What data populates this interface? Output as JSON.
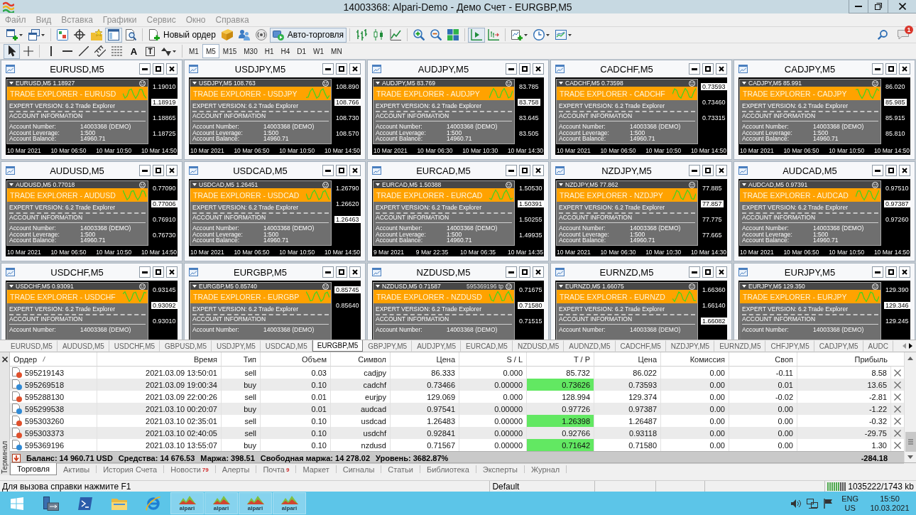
{
  "window": {
    "title": "14003368: Alpari-Demo - Демо Счет - EURGBP,M5"
  },
  "menu": [
    "Файл",
    "Вид",
    "Вставка",
    "Графики",
    "Сервис",
    "Окно",
    "Справка"
  ],
  "toolbar": [
    [
      {
        "kind": "new-chart",
        "pressed": false
      },
      {
        "kind": "profiles",
        "pressed": false
      }
    ],
    [
      {
        "kind": "market-watch",
        "pressed": false
      },
      {
        "kind": "data-window",
        "pressed": false
      },
      {
        "kind": "navigator",
        "pressed": false
      },
      {
        "kind": "terminal",
        "pressed": true
      },
      {
        "kind": "tester",
        "pressed": false
      }
    ],
    [
      {
        "kind": "new-order",
        "label": "Новый ордер",
        "pressed": false
      },
      {
        "kind": "editor",
        "pressed": false
      },
      {
        "kind": "community",
        "pressed": false
      },
      {
        "kind": "signals",
        "pressed": false
      },
      {
        "kind": "autotrading",
        "label": "Авто-торговля",
        "pressed": true
      }
    ],
    [
      {
        "kind": "bars",
        "pressed": false
      },
      {
        "kind": "candles",
        "pressed": false
      },
      {
        "kind": "line",
        "pressed": false
      }
    ],
    [
      {
        "kind": "zoom-in",
        "pressed": false
      },
      {
        "kind": "zoom-out",
        "pressed": false
      },
      {
        "kind": "tile",
        "pressed": false
      }
    ],
    [
      {
        "kind": "autoscroll",
        "pressed": true
      },
      {
        "kind": "shift",
        "pressed": false
      }
    ],
    [
      {
        "kind": "indicators",
        "pressed": false
      },
      {
        "kind": "periods",
        "pressed": false
      },
      {
        "kind": "templates",
        "pressed": false
      }
    ]
  ],
  "toolbar_right": {
    "notifications": "1"
  },
  "drawing_tools": [
    [
      {
        "kind": "cursor",
        "selected": true
      },
      {
        "kind": "crosshair",
        "selected": false
      }
    ],
    [
      {
        "kind": "vertical-line",
        "selected": false
      },
      {
        "kind": "horizontal-line",
        "selected": false
      },
      {
        "kind": "trendline",
        "selected": false
      },
      {
        "kind": "channel",
        "selected": false
      },
      {
        "kind": "fibonacci",
        "selected": false
      },
      {
        "kind": "text",
        "label": "A",
        "selected": false
      },
      {
        "kind": "text-label",
        "label": "T",
        "selected": false
      },
      {
        "kind": "arrows",
        "selected": false
      }
    ]
  ],
  "periods": [
    {
      "label": "M1",
      "selected": false
    },
    {
      "label": "M5",
      "selected": true
    },
    {
      "label": "M15",
      "selected": false
    },
    {
      "label": "M30",
      "selected": false
    },
    {
      "label": "H1",
      "selected": false
    },
    {
      "label": "H4",
      "selected": false
    },
    {
      "label": "D1",
      "selected": false
    },
    {
      "label": "W1",
      "selected": false
    },
    {
      "label": "MN",
      "selected": false
    }
  ],
  "charts": [
    {
      "title": "EURUSD,M5",
      "header": "EURUSD,M5 1.18927",
      "band": "TRADE EXPLORER - EURUSD",
      "info": [
        "EXPERT VERSION: 6.2 Trade Explorer",
        "ACCOUNT INFORMATION"
      ],
      "account": [
        {
          "label": "Account Number:",
          "value": "14003368 (DEMO)"
        },
        {
          "label": "Account Leverage:",
          "value": "1:500"
        },
        {
          "label": "Account Balance:",
          "value": "14960.71"
        }
      ],
      "prices": [
        {
          "text": "1.19010",
          "current": false
        },
        {
          "text": "1.18919",
          "current": true
        },
        {
          "text": "1.18865",
          "current": false
        },
        {
          "text": "1.18725",
          "current": false
        }
      ],
      "times": [
        "10 Mar 2021",
        "10 Mar 06:50",
        "10 Mar 10:50",
        "10 Mar 14:50"
      ]
    },
    {
      "title": "USDJPY,M5",
      "header": "USDJPY,M5 108.763",
      "band": "TRADE EXPLORER - USDJPY",
      "info": [
        "EXPERT VERSION: 6.2 Trade Explorer",
        "ACCOUNT INFORMATION"
      ],
      "account": [
        {
          "label": "Account Number:",
          "value": "14003368 (DEMO)"
        },
        {
          "label": "Account Leverage:",
          "value": "1:500"
        },
        {
          "label": "Account Balance:",
          "value": "14960.71"
        }
      ],
      "prices": [
        {
          "text": "108.890",
          "current": false
        },
        {
          "text": "108.766",
          "current": true
        },
        {
          "text": "108.730",
          "current": false
        },
        {
          "text": "108.570",
          "current": false
        }
      ],
      "times": [
        "10 Mar 2021",
        "10 Mar 06:50",
        "10 Mar 10:50",
        "10 Mar 14:50"
      ]
    },
    {
      "title": "AUDJPY,M5",
      "header": "AUDJPY,M5 83.769",
      "band": "TRADE EXPLORER - AUDJPY",
      "info": [
        "EXPERT VERSION: 6.2 Trade Explorer",
        "ACCOUNT INFORMATION"
      ],
      "account": [
        {
          "label": "Account Number:",
          "value": "14003368 (DEMO)"
        },
        {
          "label": "Account Leverage:",
          "value": "1:500"
        },
        {
          "label": "Account Balance:",
          "value": "14960.71"
        }
      ],
      "prices": [
        {
          "text": "83.785",
          "current": false
        },
        {
          "text": "83.758",
          "current": true
        },
        {
          "text": "83.645",
          "current": false
        },
        {
          "text": "83.505",
          "current": false
        }
      ],
      "times": [
        "10 Mar 2021",
        "10 Mar 06:30",
        "10 Mar 10:30",
        "10 Mar 14:30"
      ]
    },
    {
      "title": "CADCHF,M5",
      "header": "CADCHF,M5 0.73598",
      "band": "TRADE EXPLORER - CADCHF",
      "info": [
        "EXPERT VERSION: 6.2 Trade Explorer",
        "ACCOUNT INFORMATION"
      ],
      "account": [
        {
          "label": "Account Number:",
          "value": "14003368 (DEMO)"
        },
        {
          "label": "Account Leverage:",
          "value": "1:500"
        },
        {
          "label": "Account Balance:",
          "value": "14960.71"
        }
      ],
      "prices": [
        {
          "text": "0.73593",
          "current": true
        },
        {
          "text": "0.73460",
          "current": false
        },
        {
          "text": "0.73315",
          "current": false
        }
      ],
      "times": [
        "10 Mar 2021",
        "10 Mar 06:50",
        "10 Mar 10:50",
        "10 Mar 14:50"
      ]
    },
    {
      "title": "CADJPY,M5",
      "header": "CADJPY,M5 85.991",
      "band": "TRADE EXPLORER - CADJPY",
      "info": [
        "EXPERT VERSION: 6.2 Trade Explorer",
        "ACCOUNT INFORMATION"
      ],
      "account": [
        {
          "label": "Account Number:",
          "value": "14003368 (DEMO)"
        },
        {
          "label": "Account Leverage:",
          "value": "1:500"
        },
        {
          "label": "Account Balance:",
          "value": "14960.71"
        }
      ],
      "prices": [
        {
          "text": "86.020",
          "current": false
        },
        {
          "text": "85.985",
          "current": true
        },
        {
          "text": "85.915",
          "current": false
        },
        {
          "text": "85.810",
          "current": false
        }
      ],
      "times": [
        "10 Mar 2021",
        "10 Mar 06:50",
        "10 Mar 10:50",
        "10 Mar 14:50"
      ]
    },
    {
      "title": "AUDUSD,M5",
      "header": "AUDUSD,M5 0.77018",
      "band": "TRADE EXPLORER - AUDUSD",
      "info": [
        "EXPERT VERSION: 6.2 Trade Explorer",
        "ACCOUNT INFORMATION"
      ],
      "account": [
        {
          "label": "Account Number:",
          "value": "14003368 (DEMO)"
        },
        {
          "label": "Account Leverage:",
          "value": "1:500"
        },
        {
          "label": "Account Balance:",
          "value": "14960.71"
        }
      ],
      "prices": [
        {
          "text": "0.77090",
          "current": false
        },
        {
          "text": "0.77006",
          "current": true
        },
        {
          "text": "0.76910",
          "current": false
        },
        {
          "text": "0.76730",
          "current": false
        }
      ],
      "times": [
        "10 Mar 2021",
        "10 Mar 06:50",
        "10 Mar 10:50",
        "10 Mar 14:50"
      ]
    },
    {
      "title": "USDCAD,M5",
      "header": "USDCAD,M5 1.26451",
      "band": "TRADE EXPLORER - USDCAD",
      "info": [
        "EXPERT VERSION: 6.2 Trade Explorer",
        "ACCOUNT INFORMATION"
      ],
      "account": [
        {
          "label": "Account Number:",
          "value": "14003368 (DEMO)"
        },
        {
          "label": "Account Leverage:",
          "value": "1:500"
        },
        {
          "label": "Account Balance:",
          "value": "14960.71"
        }
      ],
      "prices": [
        {
          "text": "1.26790",
          "current": false
        },
        {
          "text": "1.26620",
          "current": false
        },
        {
          "text": "1.26463",
          "current": true
        }
      ],
      "times": [
        "10 Mar 2021",
        "10 Mar 06:50",
        "10 Mar 10:50",
        "10 Mar 14:50"
      ]
    },
    {
      "title": "EURCAD,M5",
      "header": "EURCAD,M5 1.50388",
      "band": "TRADE EXPLORER - EURCAD",
      "info": [
        "EXPERT VERSION: 6.2 Trade Explorer",
        "ACCOUNT INFORMATION"
      ],
      "account": [
        {
          "label": "Account Number:",
          "value": "14003368 (DEMO)"
        },
        {
          "label": "Account Leverage:",
          "value": "1:500"
        },
        {
          "label": "Account Balance:",
          "value": "14960.71"
        }
      ],
      "prices": [
        {
          "text": "1.50530",
          "current": false
        },
        {
          "text": "1.50391",
          "current": true
        },
        {
          "text": "1.50255",
          "current": false
        },
        {
          "text": "1.49935",
          "current": false
        }
      ],
      "times": [
        "9 Mar 2021",
        "9 Mar 22:35",
        "10 Mar 06:35",
        "10 Mar 14:35"
      ]
    },
    {
      "title": "NZDJPY,M5",
      "header": "NZDJPY,M5 77.862",
      "band": "TRADE EXPLORER - NZDJPY",
      "info": [
        "EXPERT VERSION: 6.2 Trade Explorer",
        "ACCOUNT INFORMATION"
      ],
      "account": [
        {
          "label": "Account Number:",
          "value": "14003368 (DEMO)"
        },
        {
          "label": "Account Leverage:",
          "value": "1:500"
        },
        {
          "label": "Account Balance:",
          "value": "14960.71"
        }
      ],
      "prices": [
        {
          "text": "77.885",
          "current": false
        },
        {
          "text": "77.857",
          "current": true
        },
        {
          "text": "77.775",
          "current": false
        },
        {
          "text": "77.665",
          "current": false
        }
      ],
      "times": [
        "10 Mar 2021",
        "10 Mar 06:30",
        "10 Mar 10:30",
        "10 Mar 14:30"
      ]
    },
    {
      "title": "AUDCAD,M5",
      "header": "AUDCAD,M5 0.97391",
      "band": "TRADE EXPLORER - AUDCAD",
      "info": [
        "EXPERT VERSION: 6.2 Trade Explorer",
        "ACCOUNT INFORMATION"
      ],
      "account": [
        {
          "label": "Account Number:",
          "value": "14003368 (DEMO)"
        },
        {
          "label": "Account Leverage:",
          "value": "1:500"
        },
        {
          "label": "Account Balance:",
          "value": "14960.71"
        }
      ],
      "prices": [
        {
          "text": "0.97510",
          "current": false
        },
        {
          "text": "0.97387",
          "current": true
        },
        {
          "text": "0.97260",
          "current": false
        }
      ],
      "times": [
        "10 Mar 2021",
        "10 Mar 06:50",
        "10 Mar 10:50",
        "10 Mar 14:50"
      ]
    },
    {
      "title": "USDCHF,M5",
      "header": "USDCHF,M5 0.93091",
      "band": "TRADE EXPLORER - USDCHF",
      "info": [
        "EXPERT VERSION: 6.2 Trade Explorer",
        "ACCOUNT INFORMATION"
      ],
      "account": [
        {
          "label": "Account Number:",
          "value": "14003368 (DEMO)"
        }
      ],
      "prices": [
        {
          "text": "0.93145",
          "current": false
        },
        {
          "text": "0.93092",
          "current": true
        },
        {
          "text": "0.93010",
          "current": false
        }
      ]
    },
    {
      "title": "EURGBP,M5",
      "header": "EURGBP,M5 0.85740",
      "band": "TRADE EXPLORER - EURGBP",
      "info": [
        "EXPERT VERSION: 6.2 Trade Explorer",
        "ACCOUNT INFORMATION"
      ],
      "account": [
        {
          "label": "Account Number:",
          "value": "14003368 (DEMO)"
        }
      ],
      "prices": [
        {
          "text": "0.85745",
          "current": true
        },
        {
          "text": "0.85640",
          "current": false
        }
      ]
    },
    {
      "title": "NZDUSD,M5",
      "header": "NZDUSD,M5 0.71587",
      "order_label": "595369196 tp",
      "band": "TRADE EXPLORER - NZDUSD",
      "info": [
        "EXPERT VERSION: 6.2 Trade Explorer",
        "ACCOUNT INFORMATION"
      ],
      "account": [
        {
          "label": "Account Number:",
          "value": "14003368 (DEMO)"
        }
      ],
      "prices": [
        {
          "text": "0.71675",
          "current": false
        },
        {
          "text": "0.71580",
          "current": true
        },
        {
          "text": "0.71515",
          "current": false
        }
      ]
    },
    {
      "title": "EURNZD,M5",
      "header": "EURNZD,M5 1.66075",
      "band": "TRADE EXPLORER - EURNZD",
      "info": [
        "EXPERT VERSION: 6.2 Trade Explorer",
        "ACCOUNT INFORMATION"
      ],
      "account": [
        {
          "label": "Account Number:",
          "value": "14003368 (DEMO)"
        }
      ],
      "prices": [
        {
          "text": "1.66360",
          "current": false
        },
        {
          "text": "1.66140",
          "current": false
        },
        {
          "text": "1.66082",
          "current": true
        }
      ]
    },
    {
      "title": "EURJPY,M5",
      "header": "EURJPY,M5 129.350",
      "band": "TRADE EXPLORER - EURJPY",
      "info": [
        "EXPERT VERSION: 6.2 Trade Explorer",
        "ACCOUNT INFORMATION"
      ],
      "account": [
        {
          "label": "Account Number:",
          "value": "14003368 (DEMO)"
        }
      ],
      "prices": [
        {
          "text": "129.390",
          "current": false
        },
        {
          "text": "129.346",
          "current": true
        },
        {
          "text": "129.245",
          "current": false
        }
      ]
    }
  ],
  "chart_tabs": [
    {
      "label": "EURUSD,M5",
      "selected": false
    },
    {
      "label": "AUDUSD,M5",
      "selected": false
    },
    {
      "label": "USDCHF,M5",
      "selected": false
    },
    {
      "label": "GBPUSD,M5",
      "selected": false
    },
    {
      "label": "USDJPY,M5",
      "selected": false
    },
    {
      "label": "USDCAD,M5",
      "selected": false
    },
    {
      "label": "EURGBP,M5",
      "selected": true
    },
    {
      "label": "GBPJPY,M5",
      "selected": false
    },
    {
      "label": "AUDJPY,M5",
      "selected": false
    },
    {
      "label": "EURCAD,M5",
      "selected": false
    },
    {
      "label": "NZDUSD,M5",
      "selected": false
    },
    {
      "label": "AUDNZD,M5",
      "selected": false
    },
    {
      "label": "CADCHF,M5",
      "selected": false
    },
    {
      "label": "NZDJPY,M5",
      "selected": false
    },
    {
      "label": "EURNZD,M5",
      "selected": false
    },
    {
      "label": "CHFJPY,M5",
      "selected": false
    },
    {
      "label": "CADJPY,M5",
      "selected": false
    },
    {
      "label": "AUDC",
      "selected": false
    }
  ],
  "terminal": {
    "side_title": "Терминал",
    "columns": [
      "Ордер",
      "Время",
      "Тип",
      "Объем",
      "Символ",
      "Цена",
      "S / L",
      "T / P",
      "Цена",
      "Комиссия",
      "Своп",
      "Прибыль"
    ],
    "rows": [
      {
        "kind": "sell",
        "tp_highlight": false,
        "cells": [
          "595219143",
          "2021.03.09 13:50:01",
          "sell",
          "0.03",
          "cadjpy",
          "86.333",
          "0.000",
          "85.732",
          "86.022",
          "0.00",
          "-0.11",
          "8.58"
        ]
      },
      {
        "kind": "buy",
        "tp_highlight": true,
        "cells": [
          "595269518",
          "2021.03.09 19:00:34",
          "buy",
          "0.10",
          "cadchf",
          "0.73466",
          "0.00000",
          "0.73626",
          "0.73593",
          "0.00",
          "0.01",
          "13.65"
        ]
      },
      {
        "kind": "sell",
        "tp_highlight": false,
        "cells": [
          "595288130",
          "2021.03.09 22:00:26",
          "sell",
          "0.01",
          "eurjpy",
          "129.069",
          "0.000",
          "128.994",
          "129.374",
          "0.00",
          "-0.02",
          "-2.81"
        ]
      },
      {
        "kind": "buy",
        "tp_highlight": false,
        "cells": [
          "595299538",
          "2021.03.10 00:20:07",
          "buy",
          "0.01",
          "audcad",
          "0.97541",
          "0.00000",
          "0.97726",
          "0.97387",
          "0.00",
          "0.00",
          "-1.22"
        ]
      },
      {
        "kind": "sell",
        "tp_highlight": true,
        "cells": [
          "595303260",
          "2021.03.10 02:35:01",
          "sell",
          "0.10",
          "usdcad",
          "1.26483",
          "0.00000",
          "1.26398",
          "1.26487",
          "0.00",
          "0.00",
          "-0.32"
        ]
      },
      {
        "kind": "sell",
        "tp_highlight": false,
        "cells": [
          "595303373",
          "2021.03.10 02:40:05",
          "sell",
          "0.10",
          "usdchf",
          "0.92841",
          "0.00000",
          "0.92766",
          "0.93118",
          "0.00",
          "0.00",
          "-29.75"
        ]
      },
      {
        "kind": "buy",
        "tp_highlight": true,
        "cells": [
          "595369196",
          "2021.03.10 13:55:07",
          "buy",
          "0.10",
          "nzdusd",
          "0.71567",
          "0.00000",
          "0.71642",
          "0.71580",
          "0.00",
          "0.00",
          "1.30"
        ]
      }
    ],
    "summary": [
      "Баланс: 14 960.71 USD",
      "Средства: 14 676.53",
      "Маржа: 398.51",
      "Свободная маржа: 14 278.02",
      "Уровень: 3682.87%"
    ],
    "total": "-284.18",
    "tabs": [
      {
        "label": "Торговля",
        "selected": true
      },
      {
        "label": "Активы",
        "selected": false
      },
      {
        "label": "История Счета",
        "selected": false
      },
      {
        "label": "Новости",
        "badge": "79",
        "selected": false
      },
      {
        "label": "Алерты",
        "selected": false
      },
      {
        "label": "Почта",
        "badge": "9",
        "selected": false
      },
      {
        "label": "Маркет",
        "selected": false
      },
      {
        "label": "Сигналы",
        "selected": false
      },
      {
        "label": "Статьи",
        "selected": false
      },
      {
        "label": "Библиотека",
        "selected": false
      },
      {
        "label": "Эксперты",
        "selected": false
      },
      {
        "label": "Журнал",
        "selected": false
      }
    ]
  },
  "status_bar": {
    "help": "Для вызова справки нажмите F1",
    "profile": "Default",
    "traffic": "1035222/1743 kb"
  },
  "taskbar": {
    "apps": [
      "alpari",
      "alpari",
      "alpari",
      "alpari"
    ],
    "language": "ENG",
    "region": "US",
    "time": "15:50",
    "date": "10.03.2021"
  }
}
